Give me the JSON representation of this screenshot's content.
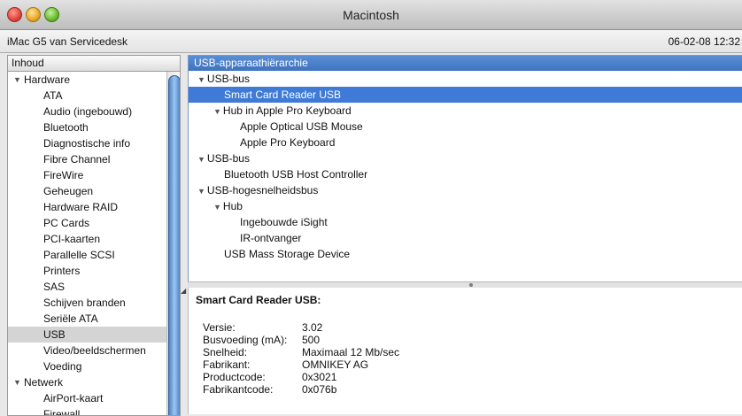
{
  "window": {
    "title": "Macintosh"
  },
  "infobar": {
    "machine": "iMac G5 van Servicedesk",
    "datetime": "06-02-08 12:32"
  },
  "sidebar": {
    "header": "Inhoud",
    "items": [
      {
        "label": "Hardware",
        "level": 0,
        "expanded": true
      },
      {
        "label": "ATA",
        "level": 1
      },
      {
        "label": "Audio (ingebouwd)",
        "level": 1
      },
      {
        "label": "Bluetooth",
        "level": 1
      },
      {
        "label": "Diagnostische info",
        "level": 1
      },
      {
        "label": "Fibre Channel",
        "level": 1
      },
      {
        "label": "FireWire",
        "level": 1
      },
      {
        "label": "Geheugen",
        "level": 1
      },
      {
        "label": "Hardware RAID",
        "level": 1
      },
      {
        "label": "PC Cards",
        "level": 1
      },
      {
        "label": "PCI-kaarten",
        "level": 1
      },
      {
        "label": "Parallelle SCSI",
        "level": 1
      },
      {
        "label": "Printers",
        "level": 1
      },
      {
        "label": "SAS",
        "level": 1
      },
      {
        "label": "Schijven branden",
        "level": 1
      },
      {
        "label": "Seriële ATA",
        "level": 1
      },
      {
        "label": "USB",
        "level": 1,
        "selected": true
      },
      {
        "label": "Video/beeldschermen",
        "level": 1
      },
      {
        "label": "Voeding",
        "level": 1
      },
      {
        "label": "Netwerk",
        "level": 0,
        "expanded": true
      },
      {
        "label": "AirPort-kaart",
        "level": 1
      },
      {
        "label": "Firewall",
        "level": 1
      }
    ]
  },
  "tree": {
    "header": "USB-apparaathiërarchie",
    "items": [
      {
        "label": "USB-bus",
        "depth": 0,
        "expandable": true
      },
      {
        "label": "Smart Card Reader USB",
        "depth": 1,
        "selected": true
      },
      {
        "label": "Hub in Apple Pro Keyboard",
        "depth": 1,
        "expandable": true
      },
      {
        "label": "Apple Optical USB Mouse",
        "depth": 2
      },
      {
        "label": "Apple Pro Keyboard",
        "depth": 2
      },
      {
        "label": "USB-bus",
        "depth": 0,
        "expandable": true
      },
      {
        "label": "Bluetooth USB Host Controller",
        "depth": 1
      },
      {
        "label": "USB-hogesnelheidsbus",
        "depth": 0,
        "expandable": true
      },
      {
        "label": "Hub",
        "depth": 1,
        "expandable": true
      },
      {
        "label": "Ingebouwde iSight",
        "depth": 2
      },
      {
        "label": "IR-ontvanger",
        "depth": 2
      },
      {
        "label": "USB Mass Storage Device",
        "depth": 1
      }
    ]
  },
  "details": {
    "title": "Smart Card Reader USB:",
    "rows": [
      {
        "key": "Versie:",
        "value": "3.02"
      },
      {
        "key": "Busvoeding (mA):",
        "value": "500"
      },
      {
        "key": "Snelheid:",
        "value": "Maximaal 12 Mb/sec"
      },
      {
        "key": "Fabrikant:",
        "value": "OMNIKEY AG"
      },
      {
        "key": "Productcode:",
        "value": "0x3021"
      },
      {
        "key": "Fabrikantcode:",
        "value": "0x076b"
      }
    ]
  },
  "icons": {
    "close": "close-icon",
    "minimize": "minimize-icon",
    "zoom": "zoom-icon",
    "disclosure": "disclosure-triangle-icon"
  },
  "colors": {
    "selection": "#3f7bd6",
    "sidebar_selection": "#d4d4d4",
    "header_blue": "#4a80cc"
  }
}
